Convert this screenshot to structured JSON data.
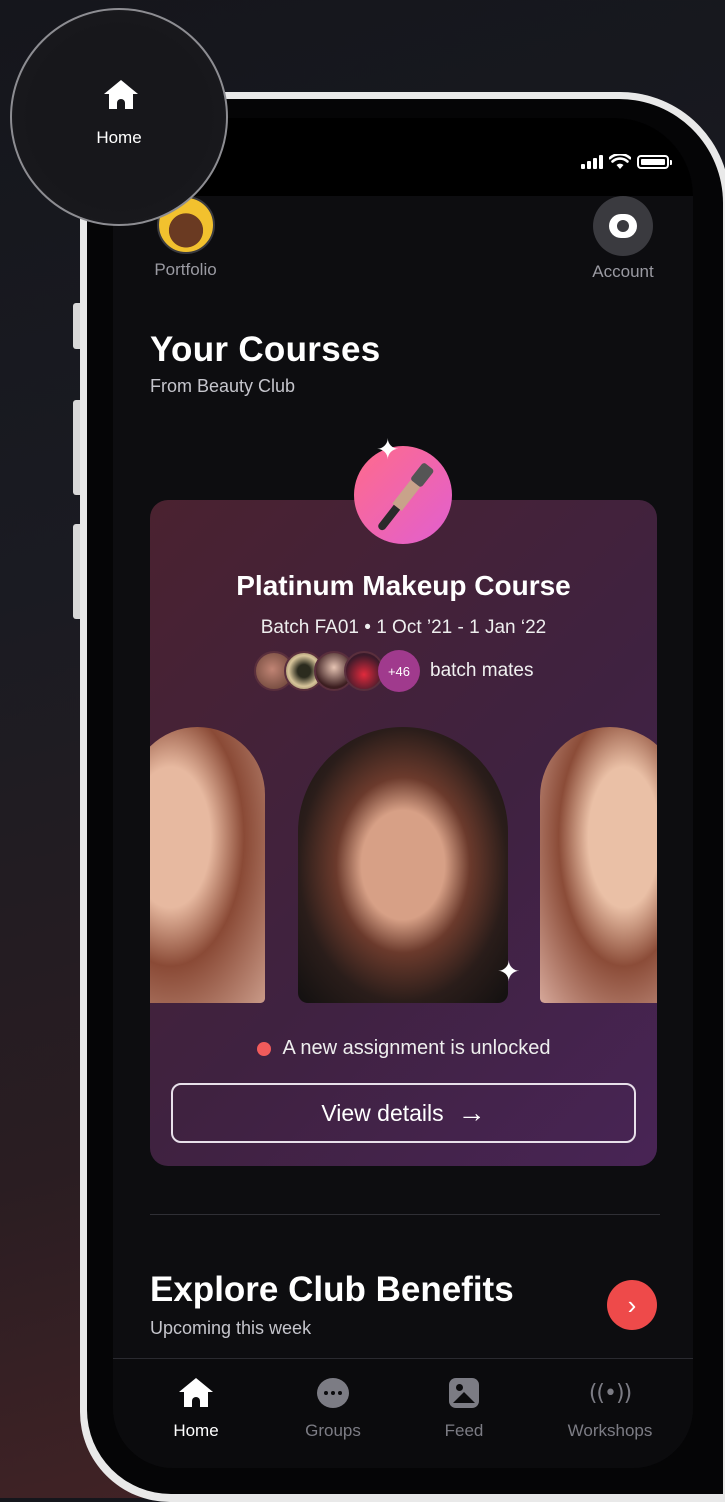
{
  "app": {
    "accent": "#ee4a4a"
  },
  "magnifier": {
    "label": "Home",
    "icon": "home-icon"
  },
  "status_bar": {
    "icons": [
      "signal-icon",
      "wifi-icon",
      "battery-icon"
    ]
  },
  "top_nav": {
    "portfolio_label": "Portfolio",
    "account_label": "Account"
  },
  "courses": {
    "title": "Your Courses",
    "subtitle": "From Beauty Club"
  },
  "course_card": {
    "title": "Platinum Makeup Course",
    "batch": "Batch FA01 • 1 Oct ’21 - 1 Jan ‘22",
    "mates_more": "+46",
    "mates_label": "batch mates",
    "assignment_text": "A new assignment is unlocked",
    "details_button": "View details",
    "details_arrow": "→"
  },
  "benefits": {
    "title": "Explore Club Benefits",
    "subtitle": "Upcoming this week",
    "go_icon": "›"
  },
  "tabs": [
    {
      "label": "Home",
      "icon": "home-icon",
      "active": true
    },
    {
      "label": "Groups",
      "icon": "chat-bubble-icon",
      "active": false
    },
    {
      "label": "Feed",
      "icon": "image-icon",
      "active": false
    },
    {
      "label": "Workshops",
      "icon": "broadcast-icon",
      "active": false
    }
  ]
}
